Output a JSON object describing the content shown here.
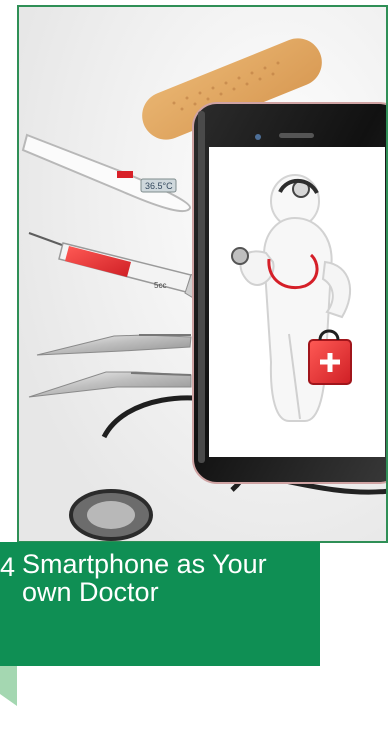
{
  "card": {
    "number": "4",
    "title": "Smartphone as Your own Doctor"
  },
  "illustration": {
    "thermometer_reading": "36.5°C",
    "syringe_volume": "5cc"
  },
  "colors": {
    "accent_green": "#0f8f54",
    "frame_green": "#2f8f56",
    "tab_green": "#a4d7b1"
  }
}
